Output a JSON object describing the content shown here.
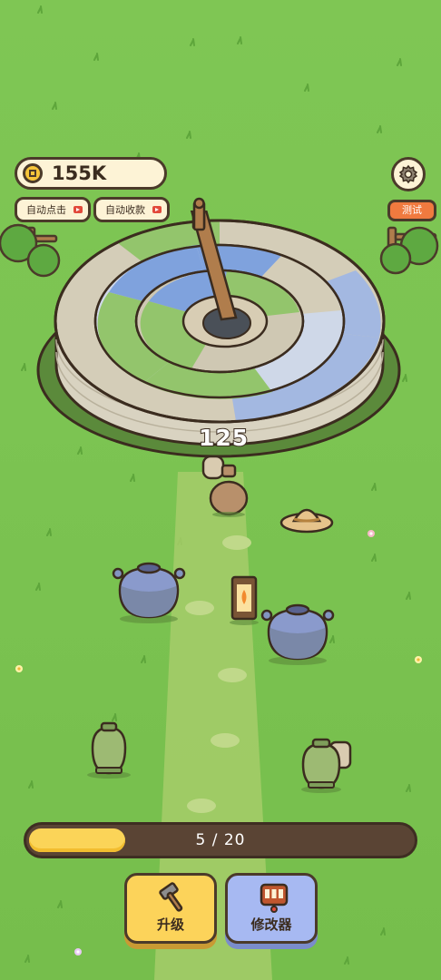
{
  "hud": {
    "coins": "155K",
    "auto_click_label": "自动点击",
    "auto_collect_label": "自动收款",
    "test_label": "测试"
  },
  "combat": {
    "damage": "125"
  },
  "progress": {
    "current": 5,
    "total": 20,
    "text": "5 / 20"
  },
  "actions": {
    "upgrade_label": "升级",
    "modify_label": "修改器"
  },
  "icons": {
    "coin": "coin-icon",
    "gear": "gear-icon",
    "ad": "video-ad-icon",
    "hammer": "hammer-icon",
    "modifier": "slot-machine-icon"
  },
  "colors": {
    "grass": "#7cc452",
    "outline": "#4b3a2a",
    "progress_fill": "#fbd458",
    "upgrade_button": "#fcd35a",
    "modify_button": "#a7b9f2",
    "test_button": "#f07a3f"
  }
}
